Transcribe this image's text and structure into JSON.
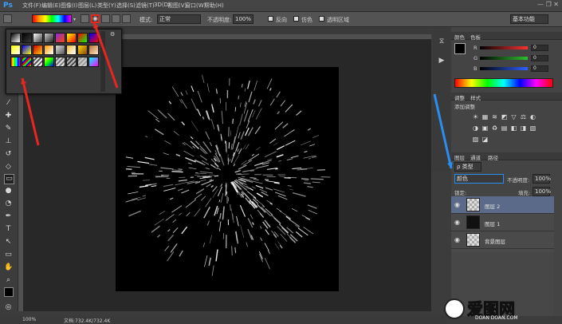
{
  "app": {
    "logo": "Ps"
  },
  "menus": [
    "文件(F)",
    "编辑(E)",
    "图像(I)",
    "图层(L)",
    "类型(Y)",
    "选择(S)",
    "滤镜(T)",
    "3D(D)",
    "视图(V)",
    "窗口(W)",
    "帮助(H)"
  ],
  "window_controls": "—  ❐  ✕",
  "options_bar": {
    "mode_label": "模式:",
    "mode_value": "正常",
    "opacity_label": "不透明度:",
    "opacity_value": "100%",
    "reverse_label": "反向",
    "dither_label": "仿色",
    "transparency_label": "透明区域",
    "workspace_value": "基本功能"
  },
  "status_bar": {
    "zoom": "100%",
    "doc": "文档:732.4K/732.4K"
  },
  "color_panel": {
    "tabs": [
      "颜色",
      "色板"
    ],
    "sliders": [
      {
        "label": "R",
        "value": "0",
        "color": "#ff3030"
      },
      {
        "label": "G",
        "value": "0",
        "color": "#30c030"
      },
      {
        "label": "B",
        "value": "0",
        "color": "#3060ff"
      }
    ]
  },
  "adjust_panel": {
    "tabs": [
      "调整",
      "样式"
    ],
    "title": "添加调整",
    "icons": [
      "☀",
      "▦",
      "≋",
      "◩",
      "▽",
      "⚖",
      "◐",
      "◑",
      "▣",
      "♻",
      "▤",
      "◧",
      "◨",
      "▧",
      "▨",
      "◪"
    ]
  },
  "layers_panel": {
    "tabs": [
      "图层",
      "通道",
      "路径"
    ],
    "filter_label": "ρ 类型",
    "blend_mode": "颜色",
    "opacity_label": "不透明度:",
    "opacity_value": "100%",
    "lock_label": "锁定:",
    "fill_label": "填充:",
    "fill_value": "100%",
    "layers": [
      {
        "name": "图层 2",
        "thumb": "checker",
        "selected": true
      },
      {
        "name": "图层 1",
        "thumb": "dark",
        "selected": false
      },
      {
        "name": "背景图层",
        "thumb": "checker",
        "selected": false
      }
    ]
  },
  "annotations": {
    "red_arrow_color": "#e8251f",
    "blue_arrow_color": "#2a8ef0"
  },
  "watermark": {
    "title": "爱图网",
    "subtitle": "DOAN DOAN.COM"
  },
  "gradient_swatches": [
    "linear-gradient(135deg,#000,#fff)",
    "linear-gradient(135deg,#000,#fff0)",
    "linear-gradient(135deg,#fff,#0000)",
    "linear-gradient(135deg,#ccc,#222)",
    "linear-gradient(135deg,#8a2be2,#ff4500)",
    "linear-gradient(135deg,#ff0,#f00)",
    "linear-gradient(135deg,#f00,#0f0)",
    "linear-gradient(135deg,#00f,#f00)",
    "linear-gradient(135deg,#ff0,#fff)",
    "linear-gradient(135deg,#00f,#ff0)",
    "linear-gradient(135deg,#c00,#fc0)",
    "linear-gradient(135deg,#f90,#fff)",
    "linear-gradient(135deg,#ddd,#555)",
    "linear-gradient(135deg,#f0c040,#fff)",
    "linear-gradient(135deg,#ffd700,#8b4513)",
    "linear-gradient(135deg,#b87333,#ffe4c4)",
    "linear-gradient(90deg,#f00,#ff0,#0f0,#0ff,#00f,#f0f)",
    "repeating-linear-gradient(135deg,#f00 0 2px,#0f0 2px 4px,#00f 4px 6px)",
    "repeating-linear-gradient(135deg,#eee 0 2px,#555 2px 4px)",
    "linear-gradient(135deg,#ff0,#0f0,#00f)",
    "repeating-linear-gradient(135deg,#ddd 0 2px,#777 2px 4px)",
    "repeating-linear-gradient(135deg,#bbb 0 2px,#444 2px 4px)",
    "repeating-linear-gradient(135deg,#ccc 0 2px,#999 2px 4px)",
    "linear-gradient(135deg,#0ff,#f0f)"
  ]
}
